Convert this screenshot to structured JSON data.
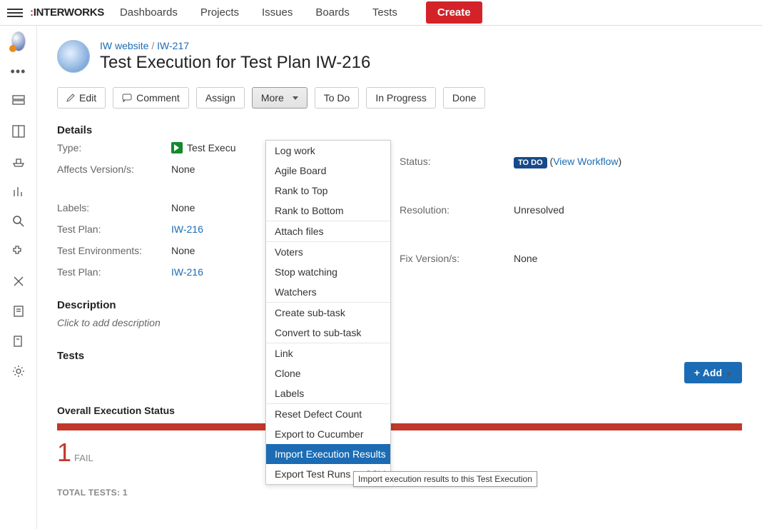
{
  "logo": "INTERWORKS",
  "nav": {
    "dashboards": "Dashboards",
    "projects": "Projects",
    "issues": "Issues",
    "boards": "Boards",
    "tests": "Tests"
  },
  "create": "Create",
  "breadcrumb": {
    "project": "IW website",
    "issue": "IW-217"
  },
  "title": "Test Execution for Test Plan IW-216",
  "actions": {
    "edit": "Edit",
    "comment": "Comment",
    "assign": "Assign",
    "more": "More",
    "todo": "To Do",
    "inprogress": "In Progress",
    "done": "Done"
  },
  "sections": {
    "details": "Details",
    "description": "Description",
    "tests": "Tests"
  },
  "details_left": {
    "type": "Type:",
    "type_val": "Test Execu",
    "affects": "Affects Version/s:",
    "affects_val": "None",
    "labels": "Labels:",
    "labels_val": "None",
    "testplan1": "Test Plan:",
    "testplan1_val": "IW-216",
    "envs": "Test Environments:",
    "envs_val": "None",
    "testplan2": "Test Plan:",
    "testplan2_val": "IW-216"
  },
  "details_right": {
    "status": "Status:",
    "status_badge": "TO DO",
    "view_workflow": "View Workflow",
    "resolution": "Resolution:",
    "resolution_val": "Unresolved",
    "fixver": "Fix Version/s:",
    "fixver_val": "None"
  },
  "desc_placeholder": "Click to add description",
  "add": "Add",
  "overall_label": "Overall Execution Status",
  "fail": {
    "num": "1",
    "label": "FAIL"
  },
  "total_tests": "TOTAL TESTS: 1",
  "dropdown": {
    "g1": {
      "logwork": "Log work",
      "agile": "Agile Board",
      "ranktop": "Rank to Top",
      "rankbottom": "Rank to Bottom"
    },
    "g2": {
      "attach": "Attach files"
    },
    "g3": {
      "voters": "Voters",
      "stopwatch": "Stop watching",
      "watchers": "Watchers"
    },
    "g4": {
      "createsub": "Create sub-task",
      "convertsub": "Convert to sub-task"
    },
    "g5": {
      "link": "Link",
      "clone": "Clone",
      "labels": "Labels"
    },
    "g6": {
      "resetdefect": "Reset Defect Count",
      "exportcuc": "Export to Cucumber",
      "importexec": "Import Execution Results",
      "exportcsv": "Export Test Runs to CSV"
    }
  },
  "tooltip": "Import execution results to this Test Execution"
}
